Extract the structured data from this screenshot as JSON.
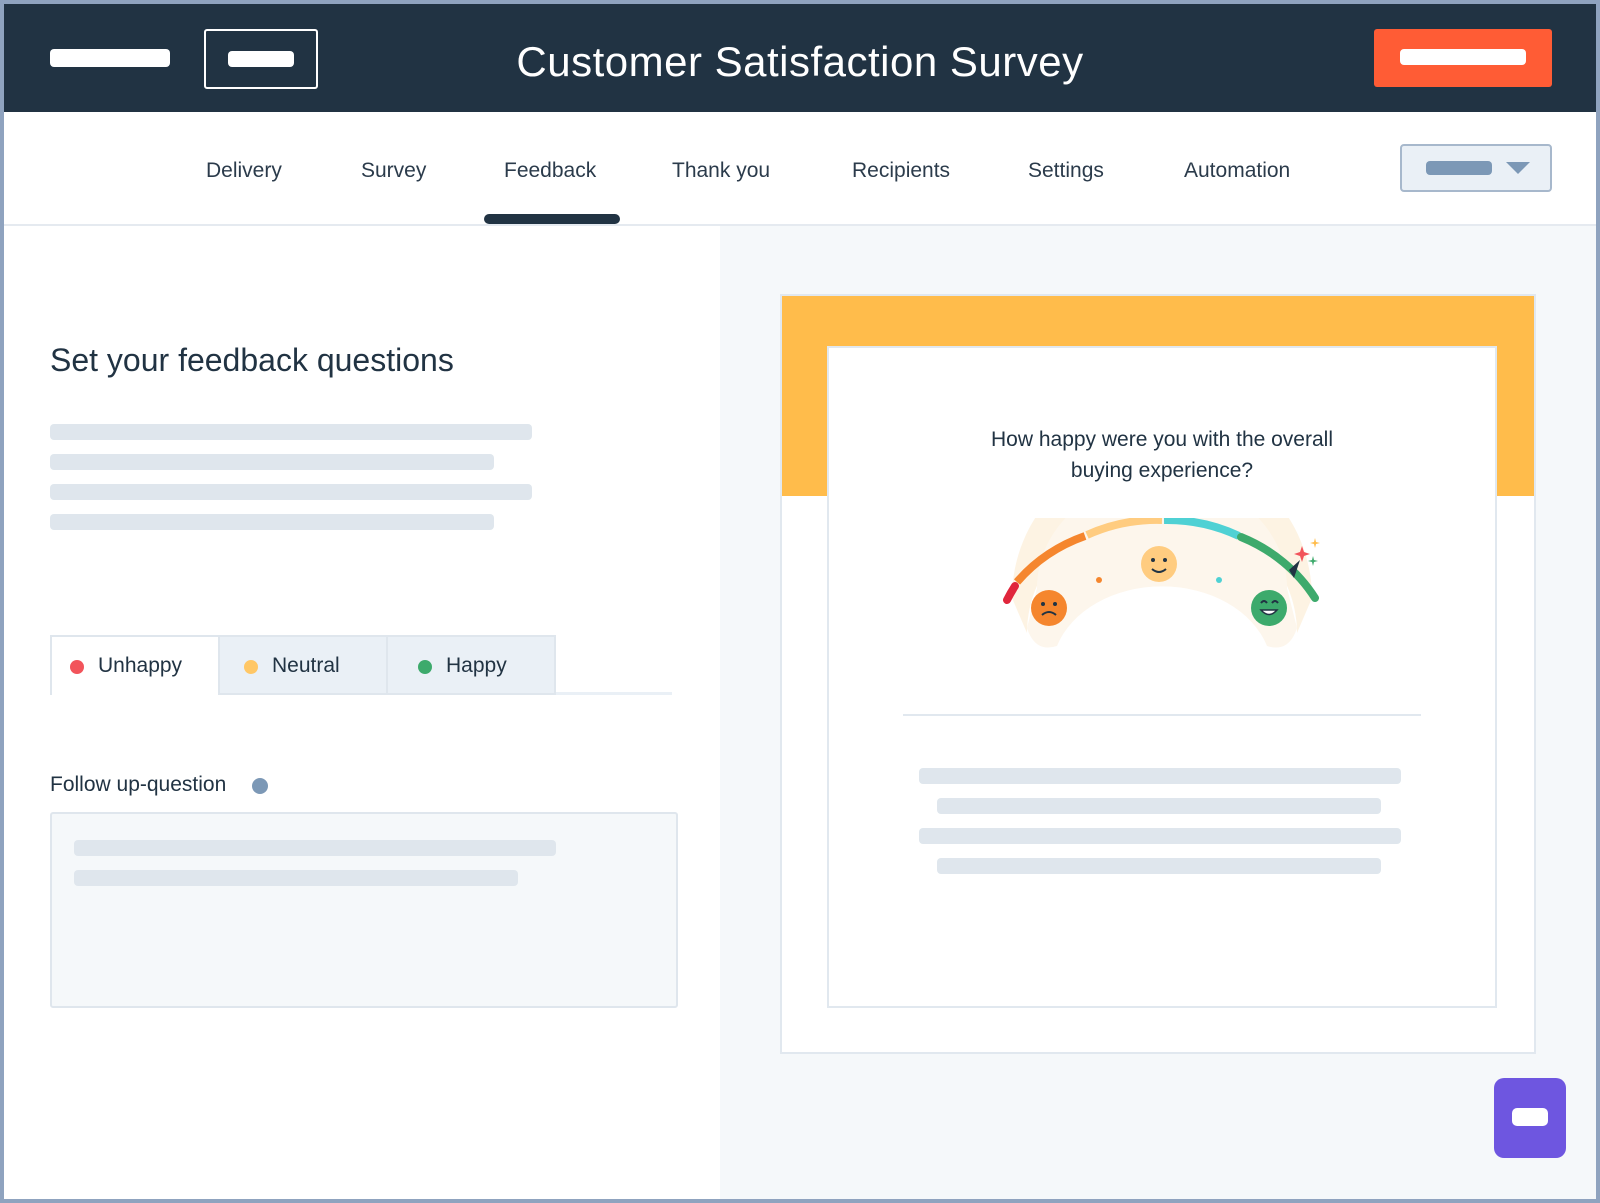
{
  "header": {
    "title": "Customer Satisfaction Survey"
  },
  "tabs": [
    {
      "label": "Delivery"
    },
    {
      "label": "Survey"
    },
    {
      "label": "Feedback",
      "active": true
    },
    {
      "label": "Thank you"
    },
    {
      "label": "Recipients"
    },
    {
      "label": "Settings"
    },
    {
      "label": "Automation"
    }
  ],
  "editor": {
    "heading": "Set your feedback questions",
    "segments": [
      {
        "label": "Unhappy",
        "color": "#f2545b",
        "active": true
      },
      {
        "label": "Neutral",
        "color": "#ffc766",
        "active": false
      },
      {
        "label": "Happy",
        "color": "#3daa6c",
        "active": false
      }
    ],
    "followup_label": "Follow up-question"
  },
  "preview": {
    "question": "How happy were you with the overall buying experience?",
    "gauge_icons": [
      "sad-face-icon",
      "neutral-face-icon",
      "happy-face-icon",
      "sparkle-icon"
    ],
    "band_color": "#ffbc4b"
  },
  "colors": {
    "header_bg": "#213343",
    "cta": "#ff5c35",
    "chat_button": "#6e56e0"
  }
}
